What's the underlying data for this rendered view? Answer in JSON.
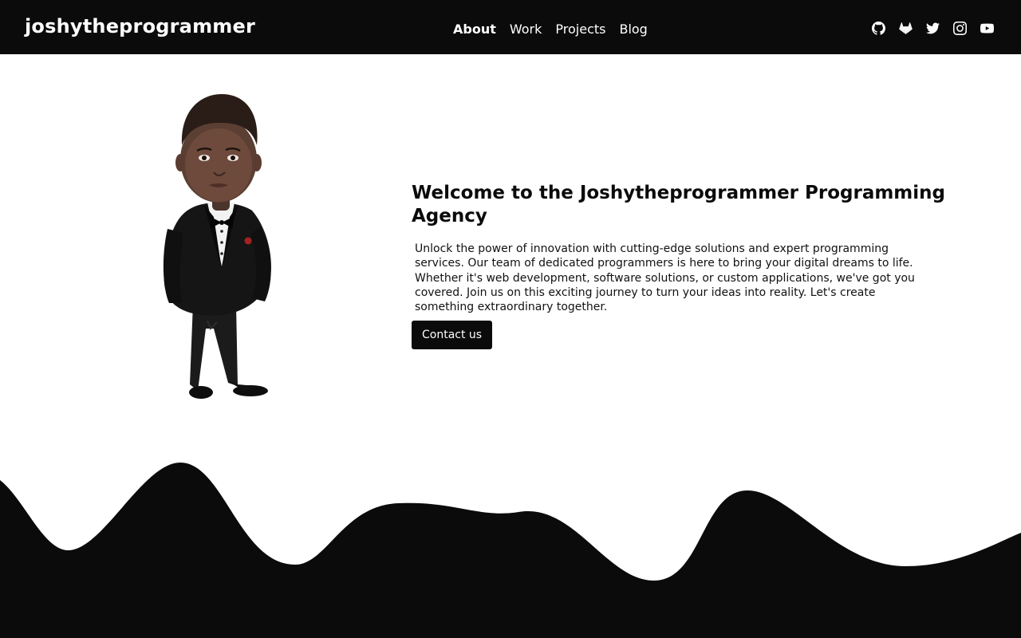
{
  "navbar": {
    "brand": "joshytheprogrammer",
    "links": [
      {
        "label": "About",
        "active": true
      },
      {
        "label": "Work",
        "active": false
      },
      {
        "label": "Projects",
        "active": false
      },
      {
        "label": "Blog",
        "active": false
      }
    ],
    "socials": [
      "github-icon",
      "gitlab-icon",
      "twitter-icon",
      "instagram-icon",
      "youtube-icon"
    ]
  },
  "hero": {
    "title": "Welcome to the Joshytheprogrammer Programming Agency",
    "description": "Unlock the power of innovation with cutting-edge solutions and expert programming services. Our team of dedicated programmers is here to bring your digital dreams to life. Whether it's web development, software solutions, or custom applications, we've got you covered. Join us on this exciting journey to turn your ideas into reality. Let's create something extraordinary together.",
    "cta_label": "Contact us"
  },
  "colors": {
    "nav_background": "#0b0b0b",
    "page_background": "#ffffff",
    "wave_fill": "#0b0b0b",
    "button_background": "#0b0b0b"
  }
}
